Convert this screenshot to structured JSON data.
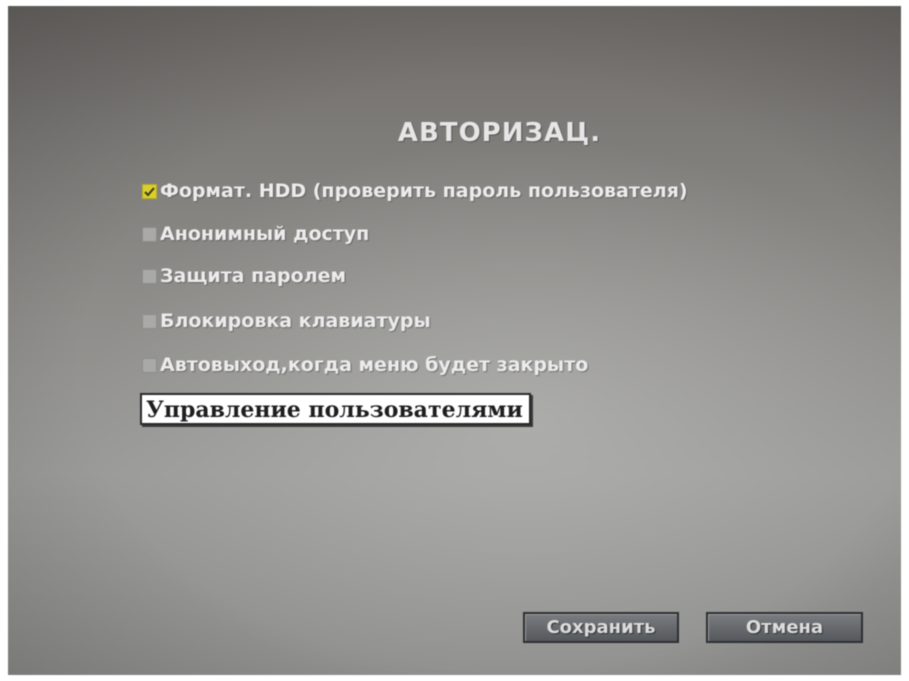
{
  "dialog": {
    "title": "АВТОРИЗАЦ."
  },
  "options": [
    {
      "label": "Формат. HDD (проверить пароль пользователя)",
      "checked": true
    },
    {
      "label": "Анонимный доступ",
      "checked": false
    },
    {
      "label": "Защита паролем",
      "checked": false
    },
    {
      "label": "Блокировка клавиатуры",
      "checked": false
    },
    {
      "label": "Автовыход,когда меню будет закрыто",
      "checked": false
    }
  ],
  "user_management_button": "Управление пользователями",
  "buttons": {
    "save": "Сохранить",
    "cancel": "Отмена"
  },
  "colors": {
    "checkbox_checked": "#d9cf2f",
    "checkbox_unchecked": "#a9a9a7",
    "text": "#ececec"
  }
}
